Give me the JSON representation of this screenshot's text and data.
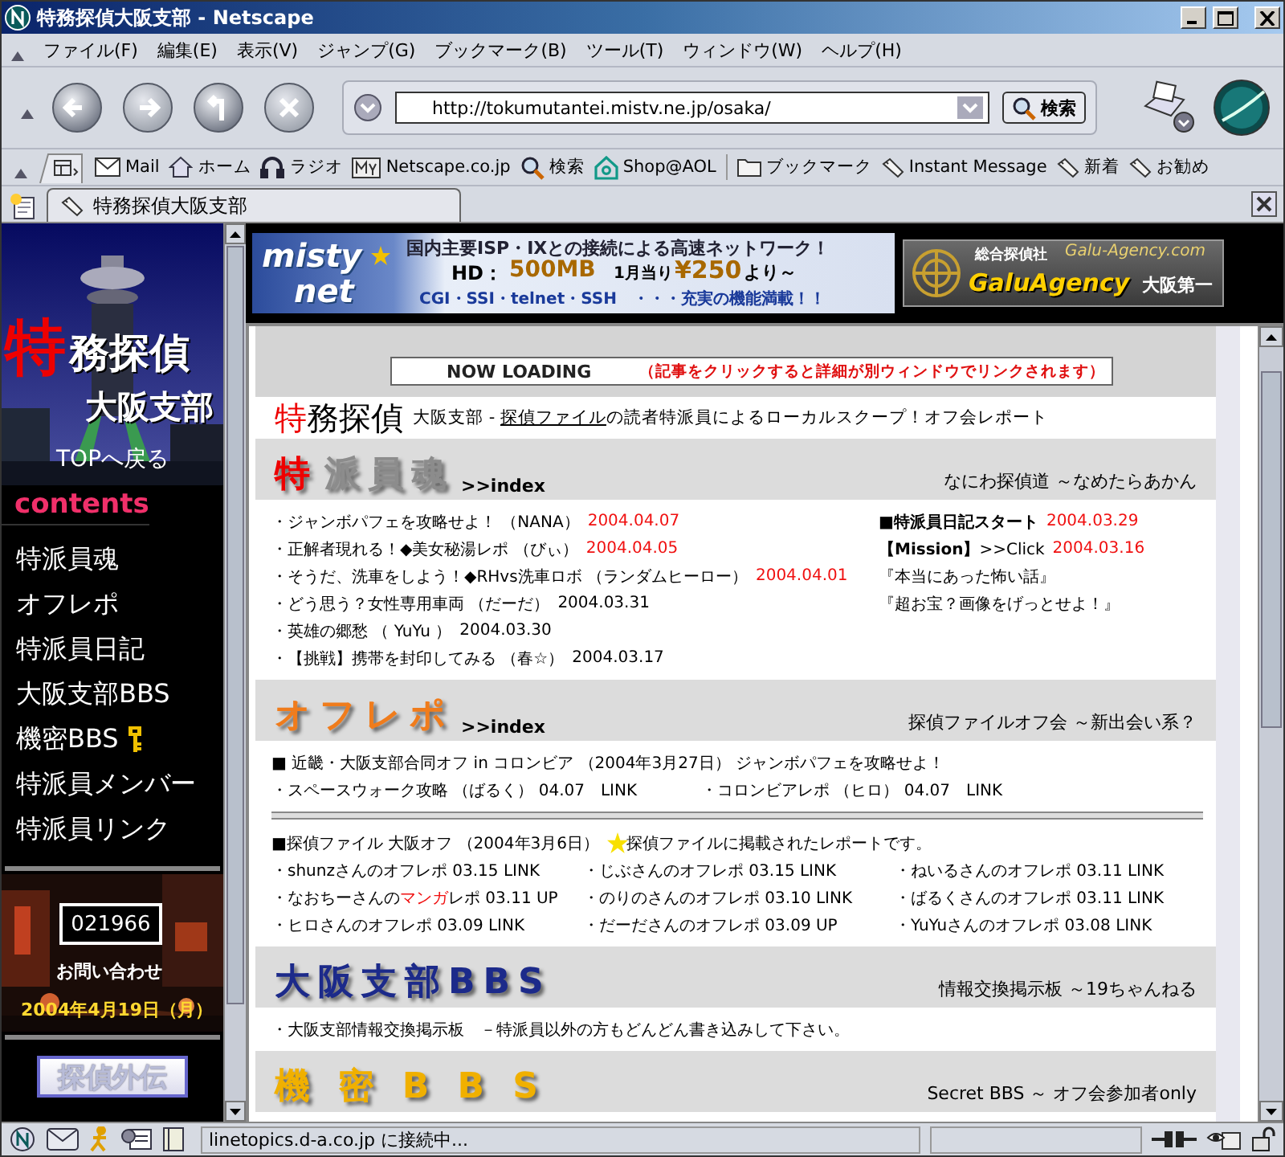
{
  "window": {
    "title": "特務探偵大阪支部 - Netscape"
  },
  "menu": [
    "ファイル(F)",
    "編集(E)",
    "表示(V)",
    "ジャンプ(G)",
    "ブックマーク(B)",
    "ツール(T)",
    "ウィンドウ(W)",
    "ヘルプ(H)"
  ],
  "address": {
    "url": "http://tokumutantei.mistv.ne.jp/osaka/",
    "search_button": "検索"
  },
  "personal_toolbar": [
    {
      "label": "Mail",
      "kind": "mail"
    },
    {
      "label": "ホーム",
      "kind": "home"
    },
    {
      "label": "ラジオ",
      "kind": "radio"
    },
    {
      "label": "Netscape.co.jp",
      "kind": "portal"
    },
    {
      "label": "検索",
      "kind": "search"
    },
    {
      "label": "Shop@AOL",
      "kind": "shop"
    },
    {
      "label": "ブックマーク",
      "kind": "folder"
    },
    {
      "label": "Instant Message",
      "kind": "bookmark"
    },
    {
      "label": "新着",
      "kind": "bookmark"
    },
    {
      "label": "お勧め",
      "kind": "bookmark"
    }
  ],
  "tab": {
    "title": "特務探偵大阪支部"
  },
  "sidebar": {
    "logo_mark": "特",
    "logo_rest": "務探偵",
    "branch": "大阪支部",
    "top_link": "TOPへ戻る",
    "heading": "contents",
    "items": [
      {
        "label": "特派員魂",
        "locked": false
      },
      {
        "label": "オフレポ",
        "locked": false
      },
      {
        "label": "特派員日記",
        "locked": false
      },
      {
        "label": "大阪支部BBS",
        "locked": false
      },
      {
        "label": "機密BBS",
        "locked": true
      },
      {
        "label": "特派員メンバー",
        "locked": false
      },
      {
        "label": "特派員リンク",
        "locked": false
      }
    ],
    "counter": "021966",
    "contact": "お問い合わせ",
    "date": "2004年4月19日（月）",
    "footer_button": "探偵外伝"
  },
  "banners": {
    "misty": {
      "logo_top": "misty",
      "logo_bottom": "net",
      "headline": "国内主要ISP・IXとの接続による高速ネットワーク！",
      "hd_label": "HD：",
      "hd_value": "500MB",
      "per_month": "1月当り",
      "price": "¥250",
      "price_suffix": "より～",
      "features": "CGI・SSI・telnet・SSH　・・・充実の機能満載！！"
    },
    "galu": {
      "company": "総合探偵社",
      "domain": "Galu-Agency.com",
      "name": "GaluAgency",
      "branch": "大阪第一"
    }
  },
  "notice": {
    "title": "NOW LOADING",
    "message": "（記事をクリックすると詳細が別ウィンドウでリンクされます）"
  },
  "intro": {
    "mark": "特",
    "rest": "務探偵",
    "before": "大阪支部 - ",
    "link": "探偵ファイル",
    "after": "の読者特派員によるローカルスクープ！オフ会レポート"
  },
  "sections": [
    {
      "title_mark": "特",
      "title": "派員魂",
      "color": "#8c8c8c",
      "index": ">>index",
      "note": "なにわ探偵道 ～なめたらあかん",
      "left": [
        {
          "text": "・ジャンボパフェを攻略せよ！ （NANA）",
          "date": "2004.04.07",
          "new": true
        },
        {
          "text": "・正解者現れる！◆美女秘湯レポ （びぃ）",
          "date": "2004.04.05",
          "new": true
        },
        {
          "text": "・そうだ、洗車をしよう！◆RHvs洗車ロボ （ランダムヒーロー）",
          "date": "2004.04.01",
          "new": true
        },
        {
          "text": "・どう思う？女性専用車両 （だーだ）",
          "date": "2004.03.31",
          "new": false
        },
        {
          "text": "・英雄の郷愁 （ YuYu ）",
          "date": "2004.03.30",
          "new": false
        },
        {
          "text": "・【挑戦】携帯を封印してみる （春☆）",
          "date": "2004.03.17",
          "new": false
        }
      ],
      "right": [
        {
          "text": "■特派員日記スタート",
          "bold": true,
          "date": "2004.03.29",
          "new": true
        },
        {
          "text": "**【Mission】**>>Click",
          "bold": false,
          "date": "2004.03.16",
          "new": true
        },
        {
          "text": "『本当にあった怖い話』",
          "bold": false
        },
        {
          "text": "『超お宝？画像をげっとせよ！』",
          "bold": false
        }
      ]
    },
    {
      "title": "オフレポ",
      "color": "#f07c1c",
      "index": ">>index",
      "note": "探偵ファイルオフ会 ～新出会い系？",
      "event": "■ 近畿・大阪支部合同オフ in コロンビア （2004年3月27日） ジャンボパフェを攻略せよ！",
      "event_links": [
        "・スペースウォーク攻略 （ばるく） 04.07　LINK",
        "・コロンビアレポ （ヒロ） 04.07　LINK"
      ],
      "report_heading": "■探偵ファイル 大阪オフ （2004年3月6日）",
      "report_note": "探偵ファイルに掲載されたレポートです。",
      "reports": [
        {
          "text": "・shunzさんのオフレポ 03.15 LINK"
        },
        {
          "text": "・じぶさんのオフレポ 03.15 LINK"
        },
        {
          "text": "・ねいるさんのオフレポ 03.11 LINK"
        },
        {
          "text": "・なおちーさんの",
          "accent": "マンガ",
          "rest": "レポ 03.11 UP"
        },
        {
          "text": "・のりのさんのオフレポ 03.10 LINK"
        },
        {
          "text": "・ばるくさんのオフレポ 03.11 LINK"
        },
        {
          "text": "・ヒロさんのオフレポ 03.09 LINK"
        },
        {
          "text": "・だーださんのオフレポ 03.09 UP"
        },
        {
          "text": "・YuYuさんのオフレポ 03.08 LINK"
        }
      ]
    },
    {
      "title": "大阪支部BBS",
      "color": "#1c2a8a",
      "note": "情報交換掲示板 ～19ちゃんねる",
      "lines": [
        "・大阪支部情報交換掲示板　－特派員以外の方もどんどん書き込みして下さい。"
      ]
    },
    {
      "title": "機 密 B B S",
      "color": "#f0b000",
      "note": "Secret BBS ～ オフ会参加者only"
    }
  ],
  "status_bar": {
    "message": "linetopics.d-a.co.jp に接続中..."
  }
}
